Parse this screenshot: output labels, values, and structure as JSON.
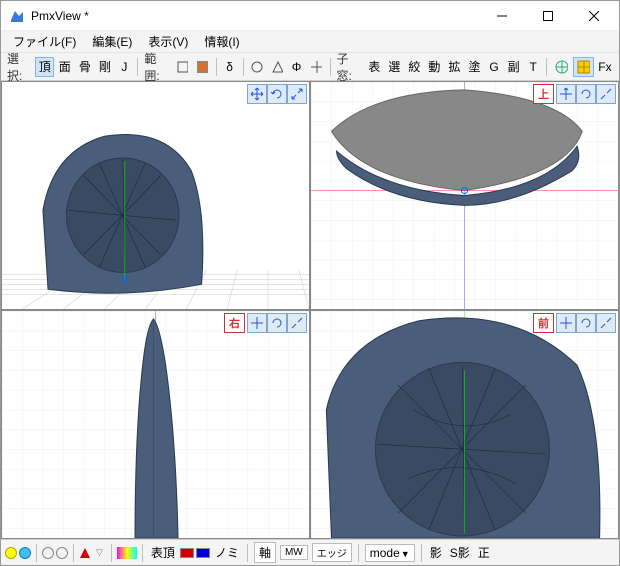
{
  "window": {
    "title": "PmxView *"
  },
  "menu": {
    "file": "ファイル(F)",
    "edit": "編集(E)",
    "view": "表示(V)",
    "info": "情報(I)"
  },
  "toolbar": {
    "select_label": "選択:",
    "btn_vertex": "頂",
    "btn_face": "面",
    "btn_bone": "骨",
    "btn_rigid": "剛",
    "btn_j": "J",
    "range_label": "範囲:",
    "btn_delta": "δ",
    "childwin_label": "子窓:",
    "btn_surface": "表",
    "btn_sel": "選",
    "btn_aux": "絞",
    "btn_move": "動",
    "btn_scale": "拡",
    "btn_paint": "塗",
    "btn_g": "G",
    "btn_sub": "副",
    "btn_t": "T",
    "btn_fx": "Fx"
  },
  "viewports": {
    "top": "上",
    "right": "右",
    "front": "前"
  },
  "statusbar": {
    "surface_top": "表頂",
    "nomi": "ノミ",
    "axis": "軸",
    "mw": "MW",
    "edge": "エッジ",
    "mode": "mode",
    "shadow": "影",
    "sshadow": "S影",
    "ortho": "正"
  }
}
